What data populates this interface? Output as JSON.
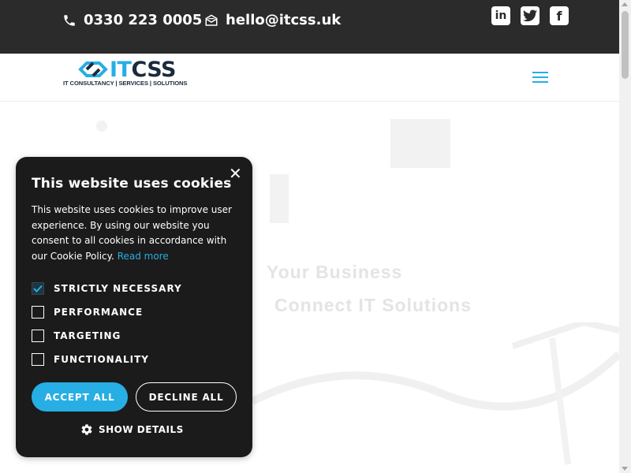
{
  "topbar": {
    "phone": "0330 223 0005",
    "email": "hello@itcss.uk",
    "social_icons": [
      "linkedin-icon",
      "twitter-icon",
      "facebook-icon"
    ],
    "background": "#2b2b2b"
  },
  "header": {
    "logo_it": "IT",
    "logo_css": "CSS",
    "logo_tagline": "IT CONSULTANCY | SERVICES | SOLUTIONS",
    "menu_icon": "hamburger-menu-icon",
    "accent": "#27aee4"
  },
  "hero": {
    "heading_line1": "Your Business",
    "heading_line2": "Connect IT Solutions"
  },
  "cookie_dialog": {
    "title": "This website uses cookies",
    "body": "This website uses cookies to improve user experience. By using our website you consent to all cookies in accordance with our Cookie Policy.",
    "read_more": "Read more",
    "options": [
      {
        "label": "STRICTLY NECESSARY",
        "checked": true
      },
      {
        "label": "PERFORMANCE",
        "checked": false
      },
      {
        "label": "TARGETING",
        "checked": false
      },
      {
        "label": "FUNCTIONALITY",
        "checked": false
      }
    ],
    "accept_label": "ACCEPT ALL",
    "decline_label": "DECLINE ALL",
    "show_details_label": "SHOW DETAILS",
    "close_icon": "close-icon",
    "background": "#1b1b1b"
  }
}
